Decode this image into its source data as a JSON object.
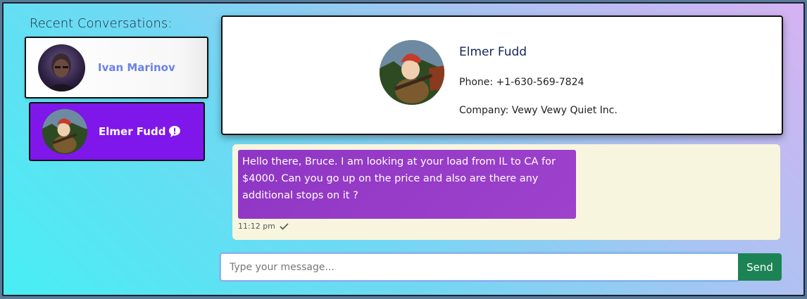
{
  "sidebar": {
    "title": "Recent Conversations:",
    "conversations": [
      {
        "name": "Ivan Marinov",
        "avatar": "person-avatar",
        "unread": false
      },
      {
        "name": "Elmer Fudd",
        "avatar": "elmer-fudd-avatar",
        "unread": true,
        "active": true
      }
    ]
  },
  "contact": {
    "name": "Elmer Fudd",
    "phone": "Phone: +1-630-569-7824",
    "company": "Company: Vewy Vewy Quiet Inc."
  },
  "messages": [
    {
      "text": "Hello there, Bruce. I am looking at your load from IL to CA for $4000. Can you go up on the price and also are there any additional stops on it ?",
      "time": "11:12 pm",
      "status_icon": "check-icon"
    }
  ],
  "composer": {
    "placeholder": "Type your message...",
    "value": "",
    "send_label": "Send"
  },
  "colors": {
    "active_conversation": "#7f16ea",
    "bubble": "#9e42cc",
    "send_button": "#1c8355",
    "chat_background": "#f8f5de"
  }
}
